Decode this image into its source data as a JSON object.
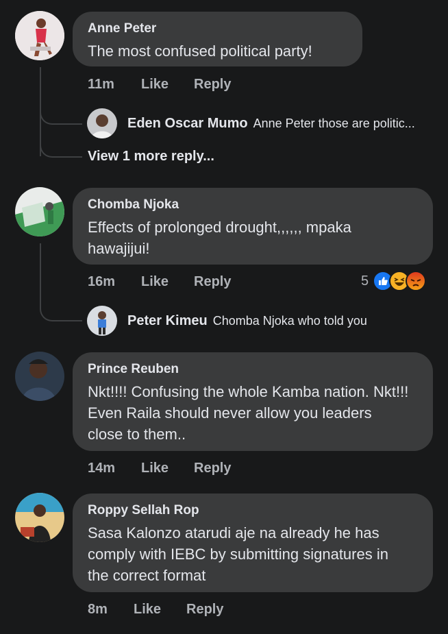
{
  "comments": [
    {
      "name": "Anne Peter",
      "text": "The most confused political party!",
      "time": "11m",
      "like": "Like",
      "reply": "Reply",
      "reply_preview": {
        "name": "Eden Oscar Mumo",
        "text": "Anne Peter those are politic..."
      },
      "view_more": "View 1 more reply..."
    },
    {
      "name": "Chomba Njoka",
      "text": "Effects of prolonged drought,,,,,, mpaka hawajijui!",
      "time": "16m",
      "like": "Like",
      "reply": "Reply",
      "reactions_count": "5",
      "reactions": [
        "like-reaction-icon",
        "haha-reaction-icon",
        "angry-reaction-icon"
      ],
      "reply_preview": {
        "name": "Peter Kimeu",
        "text": "Chomba Njoka who told you"
      }
    },
    {
      "name": "Prince Reuben",
      "text": "Nkt!!!! Confusing the whole Kamba nation. Nkt!!! Even Raila should never allow you leaders close to them..",
      "time": "14m",
      "like": "Like",
      "reply": "Reply"
    },
    {
      "name": "Roppy Sellah Rop",
      "text": "Sasa Kalonzo atarudi aje na already he has comply with IEBC by submitting signatures in  the correct format",
      "time": "8m",
      "like": "Like",
      "reply": "Reply"
    }
  ],
  "colors": {
    "background": "#18191a",
    "bubble": "#3a3b3c",
    "primary_text": "#e4e6eb",
    "secondary_text": "#b0b3b8",
    "like_blue": "#1877f2",
    "haha_yellow": "#f7b125",
    "angry_orange": "#e9710f"
  }
}
